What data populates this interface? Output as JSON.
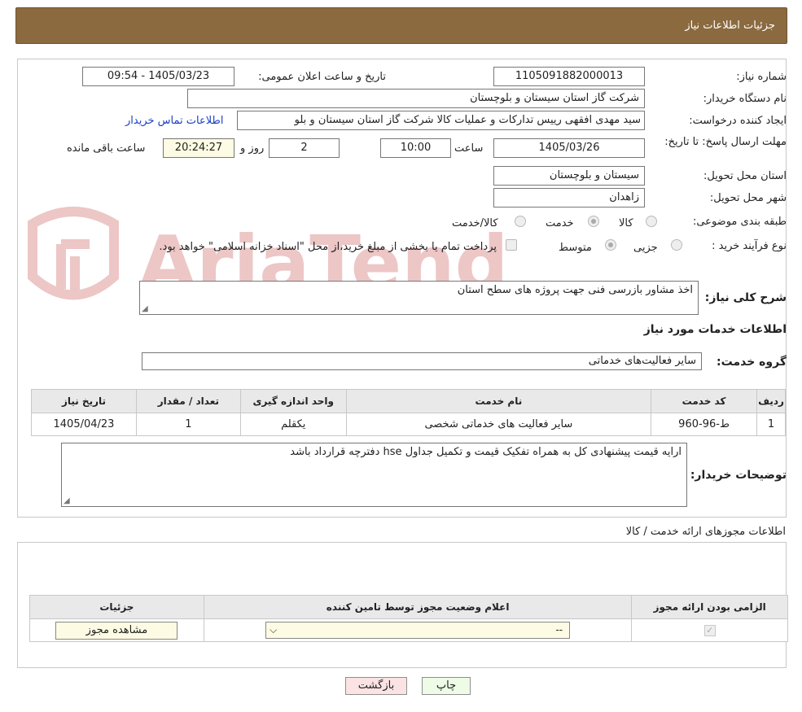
{
  "header": {
    "title": "جزئیات اطلاعات نیاز"
  },
  "form": {
    "need_number_label": "شماره نیاز:",
    "need_number": "1105091882000013",
    "announce_label": "تاریخ و ساعت اعلان عمومی:",
    "announce_value": "1405/03/23 - 09:54",
    "buyer_org_label": "نام دستگاه خریدار:",
    "buyer_org": "شرکت گاز استان سیستان و بلوچستان",
    "creator_label": "ایجاد کننده درخواست:",
    "creator": "سید مهدی افقهی رییس تدارکات و عملیات کالا شرکت گاز استان سیستان و بلو",
    "contact_link": "اطلاعات تماس خریدار",
    "deadline_label": "مهلت ارسال پاسخ: تا تاریخ:",
    "deadline_date": "1405/03/26",
    "time_label": "ساعت",
    "deadline_time": "10:00",
    "days_value": "2",
    "days_label": "روز و",
    "remaining_time": "20:24:27",
    "remaining_label": "ساعت باقی مانده",
    "province_label": "استان محل تحویل:",
    "province": "سیستان و بلوچستان",
    "city_label": "شهر محل تحویل:",
    "city": "زاهدان",
    "category_label": "طبقه بندی موضوعی:",
    "category_options": [
      "کالا",
      "خدمت",
      "کالا/خدمت"
    ],
    "category_selected": "خدمت",
    "process_label": "نوع فرآیند خرید :",
    "process_options": [
      "جزیی",
      "متوسط"
    ],
    "process_selected": "متوسط",
    "payment_note": "پرداخت تمام یا بخشی از مبلغ خرید،از محل \"اسناد خزانه اسلامی\" خواهد بود.",
    "description_label": "شرح کلی نیاز:",
    "description": "اخذ مشاور بازرسی فنی جهت پروژه های سطح استان",
    "services_title": "اطلاعات خدمات مورد نیاز",
    "service_group_label": "گروه خدمت:",
    "service_group": "سایر فعالیت‌های خدماتی",
    "buyer_notes_label": "توضیحات خریدار:",
    "buyer_notes": "ارایه قیمت پیشنهادی کل به همراه تفکیک قیمت و تکمیل جداول hse دفترچه قرارداد باشد"
  },
  "services_table": {
    "columns": [
      "ردیف",
      "کد خدمت",
      "نام خدمت",
      "واحد اندازه گیری",
      "تعداد / مقدار",
      "تاریخ نیاز"
    ],
    "rows": [
      [
        "1",
        "ط-96-960",
        "سایر فعالیت های خدماتی شخصی",
        "یکقلم",
        "1",
        "1405/04/23"
      ]
    ]
  },
  "permits": {
    "title": "اطلاعات مجوزهای ارائه خدمت / کالا",
    "columns": [
      "الزامی بودن ارائه مجوز",
      "اعلام وضعیت مجوز توسط تامین کننده",
      "جزئیات"
    ],
    "select_value": "--",
    "view_button": "مشاهده مجوز"
  },
  "buttons": {
    "print": "چاپ",
    "back": "بازگشت"
  },
  "watermark": {
    "text": "AriaTender.neT"
  },
  "colors": {
    "header_bg": "#8b6a40",
    "back_button_bg": "#fbe3e3",
    "print_button_bg": "#eefbe6",
    "link": "#1a3fbf"
  }
}
